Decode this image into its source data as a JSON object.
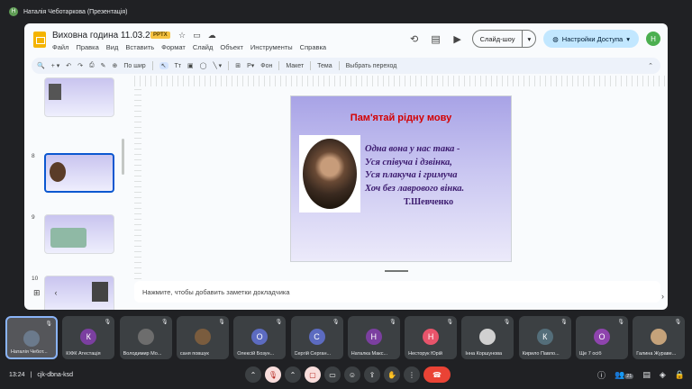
{
  "meet": {
    "presenter_label": "Наталія Чеботаркова (Презентація)",
    "presenter_initial": "Н",
    "time": "13:24",
    "meeting_code": "cjk-dbna-ksd",
    "participant_count": "21"
  },
  "slides_app": {
    "doc_title": "Виховна година 11.03.25",
    "badge": "PPTX",
    "menu": [
      "Файл",
      "Правка",
      "Вид",
      "Вставить",
      "Формат",
      "Слайд",
      "Объект",
      "Инструменты",
      "Справка"
    ],
    "slideshow_label": "Слайд-шоу",
    "share_label": "Настройки Доступа",
    "user_initial": "H",
    "toolbar": {
      "zoom_label": "По шир",
      "background_label": "Фон",
      "layout_label": "Макет",
      "theme_label": "Тема",
      "transition_label": "Выбрать переход"
    },
    "thumbnails": [
      {
        "num": "",
        "active": false
      },
      {
        "num": "8",
        "active": true
      },
      {
        "num": "9",
        "active": false
      },
      {
        "num": "10",
        "active": false
      }
    ],
    "notes_placeholder": "Нажмите, чтобы добавить заметки докладчика"
  },
  "slide": {
    "title": "Пам'ятай  рідну мову",
    "poem_lines": [
      "Одна вона у нас така -",
      "Уся співуча і дзвінка,",
      "Уся плакуча і гримуча",
      "Хоч без лаврового вінка."
    ],
    "author": "Т.Шевченко"
  },
  "tiles": [
    {
      "name": "Наталія Чебот...",
      "initial": "",
      "color": "#6b7a8c",
      "me": true
    },
    {
      "name": "КІФК Атестація",
      "initial": "К",
      "color": "#7b3fa0"
    },
    {
      "name": "Володимир Мо...",
      "initial": "",
      "color": "#6d6d6d"
    },
    {
      "name": "саня повшук",
      "initial": "",
      "color": "#7a5c3e"
    },
    {
      "name": "Олексій Бозун...",
      "initial": "О",
      "color": "#5c6bc0"
    },
    {
      "name": "Сергій Серган...",
      "initial": "С",
      "color": "#5c6bc0"
    },
    {
      "name": "Наталка Макс...",
      "initial": "Н",
      "color": "#7b3fa0"
    },
    {
      "name": "Несторук Юрій",
      "initial": "Н",
      "color": "#e8546b"
    },
    {
      "name": "Інна Коршунова",
      "initial": "",
      "color": "#d0d0d0"
    },
    {
      "name": "Кирило Павло...",
      "initial": "К",
      "color": "#546e7a"
    },
    {
      "name": "Ще 7 осіб",
      "initial": "О",
      "color": "#8e44ad"
    },
    {
      "name": "Галина Жураве...",
      "initial": "",
      "color": "#c4a27a"
    }
  ],
  "colors": {
    "slide_title": "#d40000",
    "poem": "#3b1a6e",
    "share": "#c2e7ff",
    "end_call": "#ea4335"
  }
}
